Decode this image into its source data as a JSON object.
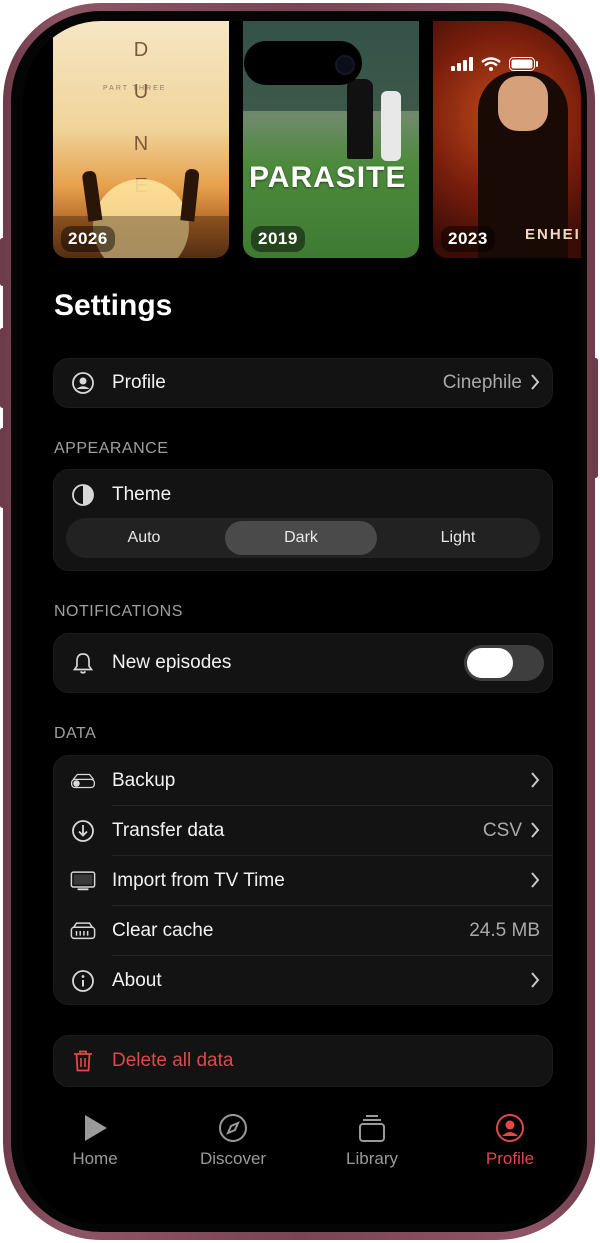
{
  "posters": [
    {
      "year": "2026",
      "title_letters": [
        "D",
        "U",
        "N",
        "E"
      ],
      "subtitle": "PART THREE"
    },
    {
      "year": "2019",
      "title": "PARASITE"
    },
    {
      "year": "2023",
      "title": "ENHEIME"
    }
  ],
  "page": {
    "title": "Settings"
  },
  "profile": {
    "label": "Profile",
    "value": "Cinephile"
  },
  "appearance": {
    "header": "APPEARANCE",
    "theme_label": "Theme",
    "options": [
      "Auto",
      "Dark",
      "Light"
    ],
    "selected": "Dark"
  },
  "notifications": {
    "header": "NOTIFICATIONS",
    "new_episodes_label": "New episodes",
    "new_episodes_on": false
  },
  "data": {
    "header": "DATA",
    "rows": [
      {
        "label": "Backup",
        "value": "",
        "icon": "drive-icon",
        "chevron": true
      },
      {
        "label": "Transfer data",
        "value": "CSV",
        "icon": "download-icon",
        "chevron": true
      },
      {
        "label": "Import from TV Time",
        "value": "",
        "icon": "tv-icon",
        "chevron": true
      },
      {
        "label": "Clear cache",
        "value": "24.5 MB",
        "icon": "storage-icon",
        "chevron": false
      },
      {
        "label": "About",
        "value": "",
        "icon": "info-icon",
        "chevron": true
      }
    ]
  },
  "danger": {
    "label": "Delete all data",
    "color": "#e0484a"
  },
  "tabs": [
    {
      "label": "Home",
      "icon": "play-icon",
      "active": false
    },
    {
      "label": "Discover",
      "icon": "compass-icon",
      "active": false
    },
    {
      "label": "Library",
      "icon": "stack-icon",
      "active": false
    },
    {
      "label": "Profile",
      "icon": "person-circle-icon",
      "active": true
    }
  ],
  "colors": {
    "accent": "#e0484a",
    "background": "#000000",
    "card": "#131313"
  }
}
